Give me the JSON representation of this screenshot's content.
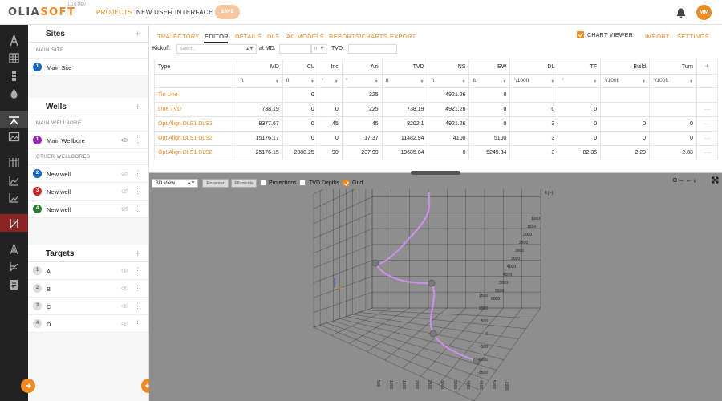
{
  "header": {
    "logo_left": "OLIA",
    "logo_right": "SOFT",
    "version": "1.0.0-DEV",
    "nav_projects": "PROJECTS",
    "nav_new_ui": "NEW USER INTERFACE",
    "save_label": "SAVE",
    "user_initials": "MM"
  },
  "sidebar": {
    "sites": {
      "title": "Sites",
      "subheading": "MAIN SITE",
      "items": [
        {
          "num": "1",
          "label": "Main Site",
          "color": "#1565c0"
        }
      ]
    },
    "wells": {
      "title": "Wells",
      "main_heading": "MAIN WELLBORE",
      "main_item": {
        "num": "1",
        "label": "Main Wellbore",
        "color": "#9c27b0"
      },
      "other_heading": "OTHER WELLBORES",
      "other_items": [
        {
          "num": "2",
          "label": "New well",
          "color": "#1565c0"
        },
        {
          "num": "3",
          "label": "New well",
          "color": "#c62828"
        },
        {
          "num": "4",
          "label": "New well",
          "color": "#2e7d32"
        }
      ]
    },
    "targets": {
      "title": "Targets",
      "items": [
        {
          "num": "1",
          "label": "A"
        },
        {
          "num": "2",
          "label": "B"
        },
        {
          "num": "3",
          "label": "C"
        },
        {
          "num": "4",
          "label": "D"
        }
      ]
    }
  },
  "tabs": {
    "items": [
      "TRAJECTORY",
      "EDITOR",
      "DETAILS",
      "DLS",
      "AC MODELS",
      "REPORTS/CHARTS",
      "EXPORT"
    ],
    "active": "EDITOR",
    "chart_viewer": "CHART VIEWER",
    "import": "IMPORT",
    "settings": "SETTINGS"
  },
  "kickoff": {
    "kickoff_label": "Kickoff:",
    "kickoff_placeholder": "Select...",
    "at_md_label": "at MD:",
    "unit": "ft",
    "tvd_label": "TVD:"
  },
  "table": {
    "columns": [
      "Type",
      "MD",
      "CL",
      "Inc",
      "Azi",
      "TVD",
      "NS",
      "EW",
      "DL",
      "TF",
      "Build",
      "Turn"
    ],
    "units": [
      "",
      "ft",
      "ft",
      "°",
      "°",
      "ft",
      "ft",
      "ft",
      "°/100ft",
      "°",
      "°/100ft",
      "°/100ft"
    ],
    "add_symbol": "+",
    "row_menu": "···",
    "rows": [
      {
        "type": "Tie Line",
        "md": "",
        "cl": "0",
        "inc": "",
        "azi": "225",
        "tvd": "",
        "ns": "4921.26",
        "ew": "0",
        "dl": "",
        "tf": "",
        "build": "",
        "turn": ""
      },
      {
        "type": "Line TVD",
        "md": "738.19",
        "cl": "0",
        "inc": "0",
        "azi": "225",
        "tvd": "738.19",
        "ns": "4921.26",
        "ew": "0",
        "dl": "0",
        "tf": "0",
        "build": "",
        "turn": ""
      },
      {
        "type": "Opt.Align DLS1 DLS2",
        "md": "8377.67",
        "cl": "0",
        "inc": "45",
        "azi": "45",
        "tvd": "8202.1",
        "ns": "4921.26",
        "ew": "0",
        "dl": "3",
        "tf": "0",
        "build": "0",
        "turn": "0"
      },
      {
        "type": "Opt.Align DLS1 DLS2",
        "md": "15176.17",
        "cl": "0",
        "inc": "0",
        "azi": "17.37",
        "tvd": "11482.94",
        "ns": "4100",
        "ew": "5100",
        "dl": "3",
        "tf": "0",
        "build": "0",
        "turn": "0"
      },
      {
        "type": "Opt.Align DLS1 DLS2",
        "md": "25176.15",
        "cl": "2888.25",
        "inc": "90",
        "azi": "-237.99",
        "tvd": "19685.04",
        "ns": "0",
        "ew": "5249.34",
        "dl": "3",
        "tf": "-82.35",
        "build": "2.29",
        "turn": "-2.83"
      }
    ]
  },
  "viewer": {
    "view_mode": "3D View",
    "recenter": "Recenter",
    "ellipsoids": "Ellipsoids",
    "projections": "Projections",
    "tvd_depths": "TVD Depths",
    "grid": "Grid",
    "grid_on": true,
    "controls": "⊕→←↓",
    "axis_top_label": "ft [+]",
    "right_ticks_upper": [
      "1000",
      "1500",
      "2000",
      "2500",
      "3000",
      "3500",
      "4000",
      "4500",
      "5000",
      "5500",
      "6000"
    ],
    "right_ticks_lower": [
      "1500",
      "1000",
      "500",
      "0",
      "-500",
      "-1000",
      "-1500"
    ],
    "bottom_ticks": [
      "500",
      "1000",
      "1500",
      "2000",
      "2500",
      "3000",
      "3500",
      "4000",
      "4500",
      "5000",
      "-1000"
    ],
    "trajectory_color": "#c990e8"
  }
}
